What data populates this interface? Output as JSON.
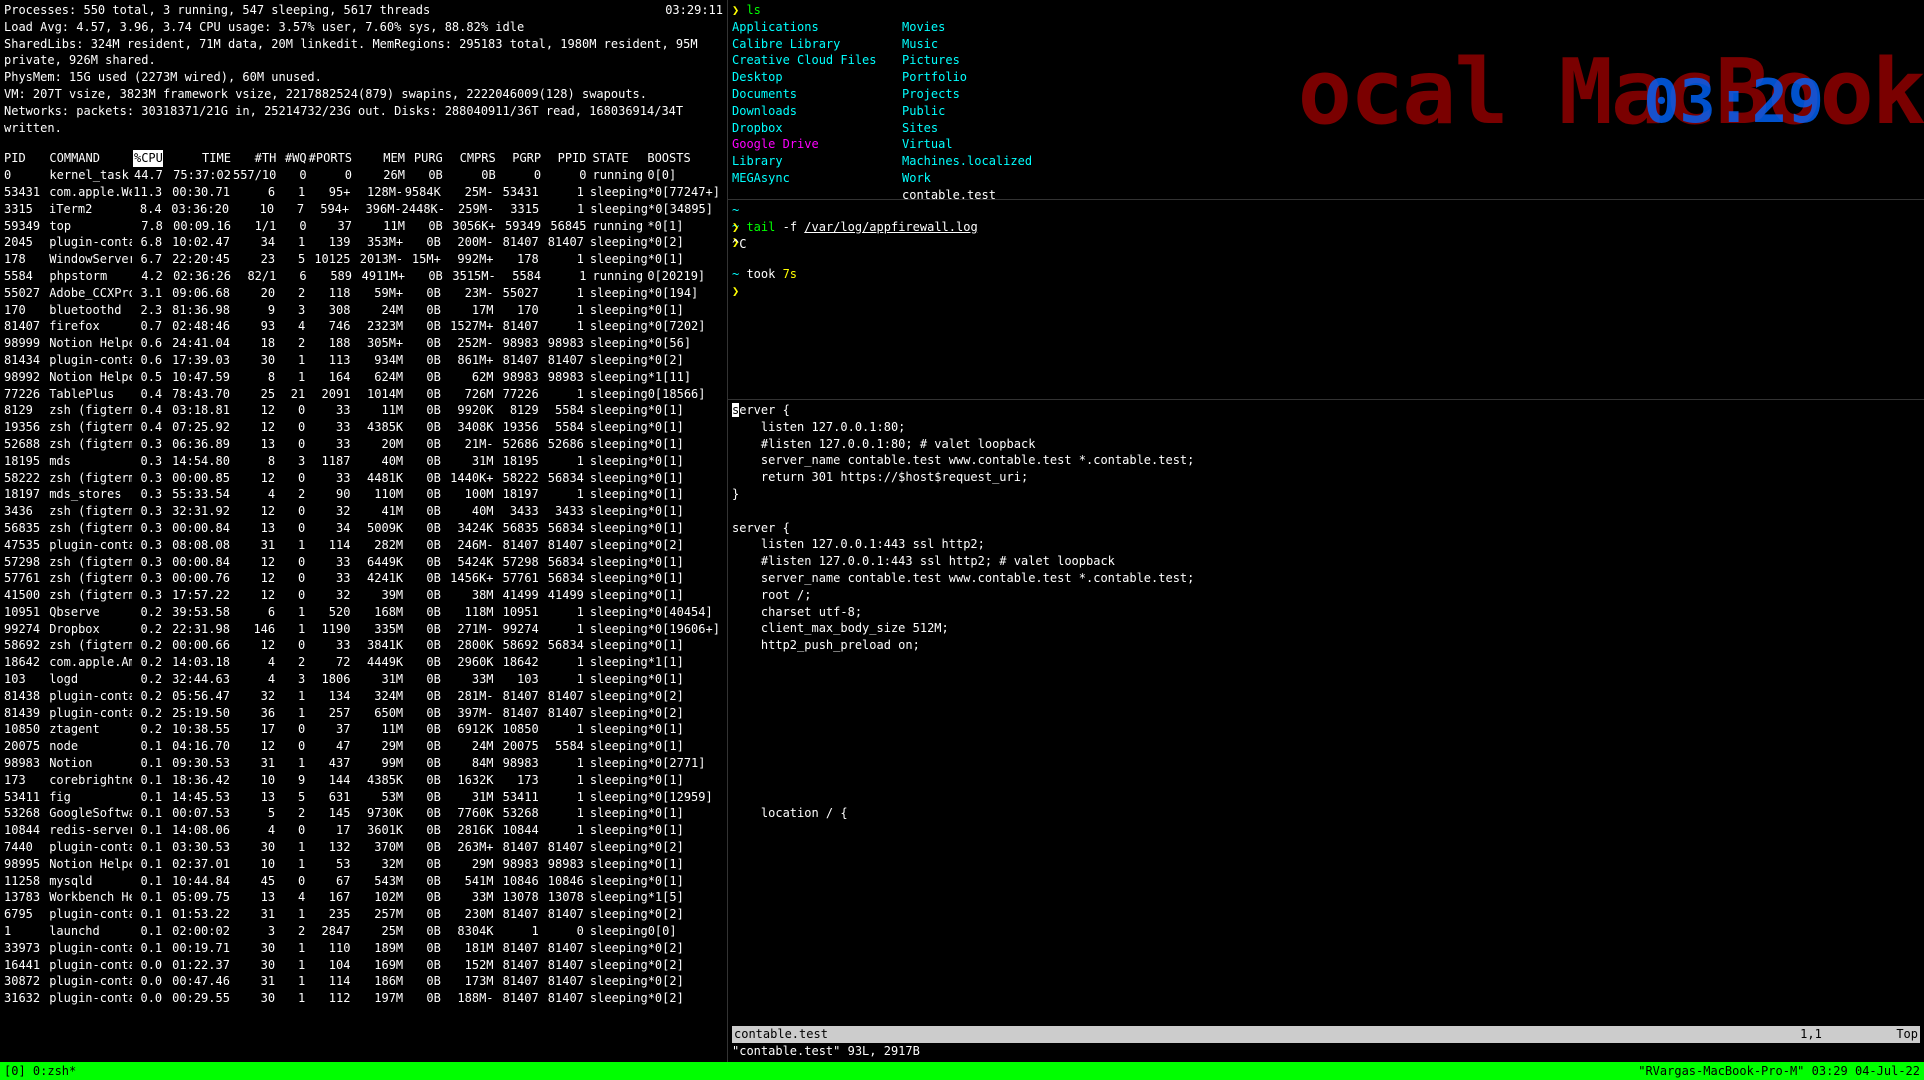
{
  "watermark": "ocal MacBook",
  "clock_time": "03:29",
  "top": {
    "summary": [
      "Processes: 550 total, 3 running, 547 sleeping, 5617 threads",
      "Load Avg: 4.57, 3.96, 3.74  CPU usage: 3.57% user, 7.60% sys, 88.82% idle",
      "SharedLibs: 324M resident, 71M data, 20M linkedit. MemRegions: 295183 total, 1980M resident, 95M private, 926M shared.",
      "PhysMem: 15G used (2273M wired), 60M unused.",
      "VM: 207T vsize, 3823M framework vsize, 2217882524(879) swapins, 2222046009(128) swapouts.",
      "Networks: packets: 30318371/21G in, 25214732/23G out. Disks: 288040911/36T read, 168036914/34T written."
    ],
    "timestamp": "03:29:11",
    "columns": [
      "PID",
      "COMMAND",
      "%CPU",
      "TIME",
      "#TH",
      "#WQ",
      "#PORTS",
      "MEM",
      "PURG",
      "CMPRS",
      "PGRP",
      "PPID",
      "STATE",
      "BOOSTS"
    ],
    "rows": [
      [
        "0",
        "kernel_task",
        "44.7",
        "75:37:02",
        "557/10",
        "0",
        "0",
        "26M",
        "0B",
        "0B",
        "0",
        "0",
        "running",
        "0[0]"
      ],
      [
        "53431",
        "com.apple.We",
        "11.3",
        "00:30.71",
        "6",
        "1",
        "95+",
        "128M-",
        "9584K",
        "25M-",
        "53431",
        "1",
        "sleeping",
        "*0[77247+]"
      ],
      [
        "3315",
        "iTerm2",
        "8.4",
        "03:36:20",
        "10",
        "7",
        "594+",
        "396M-",
        "2448K-",
        "259M-",
        "3315",
        "1",
        "sleeping",
        "*0[34895]"
      ],
      [
        "59349",
        "top",
        "7.8",
        "00:09.16",
        "1/1",
        "0",
        "37",
        "11M",
        "0B",
        "3056K+",
        "59349",
        "56845",
        "running",
        "*0[1]"
      ],
      [
        "2045",
        "plugin-conta",
        "6.8",
        "10:02.47",
        "34",
        "1",
        "139",
        "353M+",
        "0B",
        "200M-",
        "81407",
        "81407",
        "sleeping",
        "*0[2]"
      ],
      [
        "178",
        "WindowServer",
        "6.7",
        "22:20:45",
        "23",
        "5",
        "10125",
        "2013M-",
        "15M+",
        "992M+",
        "178",
        "1",
        "sleeping",
        "*0[1]"
      ],
      [
        "5584",
        "phpstorm",
        "4.2",
        "02:36:26",
        "82/1",
        "6",
        "589",
        "4911M+",
        "0B",
        "3515M-",
        "5584",
        "1",
        "running",
        "0[20219]"
      ],
      [
        "55027",
        "Adobe_CCXPro",
        "3.1",
        "09:06.68",
        "20",
        "2",
        "118",
        "59M+",
        "0B",
        "23M-",
        "55027",
        "1",
        "sleeping",
        "*0[194]"
      ],
      [
        "170",
        "bluetoothd",
        "2.3",
        "81:36.98",
        "9",
        "3",
        "308",
        "24M",
        "0B",
        "17M",
        "170",
        "1",
        "sleeping",
        "*0[1]"
      ],
      [
        "81407",
        "firefox",
        "0.7",
        "02:48:46",
        "93",
        "4",
        "746",
        "2323M",
        "0B",
        "1527M+",
        "81407",
        "1",
        "sleeping",
        "*0[7202]"
      ],
      [
        "98999",
        "Notion Helpe",
        "0.6",
        "24:41.04",
        "18",
        "2",
        "188",
        "305M+",
        "0B",
        "252M-",
        "98983",
        "98983",
        "sleeping",
        "*0[56]"
      ],
      [
        "81434",
        "plugin-conta",
        "0.6",
        "17:39.03",
        "30",
        "1",
        "113",
        "934M",
        "0B",
        "861M+",
        "81407",
        "81407",
        "sleeping",
        "*0[2]"
      ],
      [
        "98992",
        "Notion Helpe",
        "0.5",
        "10:47.59",
        "8",
        "1",
        "164",
        "624M",
        "0B",
        "62M",
        "98983",
        "98983",
        "sleeping",
        "*1[11]"
      ],
      [
        "77226",
        "TablePlus",
        "0.4",
        "78:43.70",
        "25",
        "21",
        "2091",
        "1014M",
        "0B",
        "726M",
        "77226",
        "1",
        "sleeping",
        "0[18566]"
      ],
      [
        "8129",
        "zsh (figterm",
        "0.4",
        "03:18.81",
        "12",
        "0",
        "33",
        "11M",
        "0B",
        "9920K",
        "8129",
        "5584",
        "sleeping",
        "*0[1]"
      ],
      [
        "19356",
        "zsh (figterm",
        "0.4",
        "07:25.92",
        "12",
        "0",
        "33",
        "4385K",
        "0B",
        "3408K",
        "19356",
        "5584",
        "sleeping",
        "*0[1]"
      ],
      [
        "52688",
        "zsh (figterm",
        "0.3",
        "06:36.89",
        "13",
        "0",
        "33",
        "20M",
        "0B",
        "21M-",
        "52686",
        "52686",
        "sleeping",
        "*0[1]"
      ],
      [
        "18195",
        "mds",
        "0.3",
        "14:54.80",
        "8",
        "3",
        "1187",
        "40M",
        "0B",
        "31M",
        "18195",
        "1",
        "sleeping",
        "*0[1]"
      ],
      [
        "58222",
        "zsh (figterm",
        "0.3",
        "00:00.85",
        "12",
        "0",
        "33",
        "4481K",
        "0B",
        "1440K+",
        "58222",
        "56834",
        "sleeping",
        "*0[1]"
      ],
      [
        "18197",
        "mds_stores",
        "0.3",
        "55:33.54",
        "4",
        "2",
        "90",
        "110M",
        "0B",
        "100M",
        "18197",
        "1",
        "sleeping",
        "*0[1]"
      ],
      [
        "3436",
        "zsh (figterm",
        "0.3",
        "32:31.92",
        "12",
        "0",
        "32",
        "41M",
        "0B",
        "40M",
        "3433",
        "3433",
        "sleeping",
        "*0[1]"
      ],
      [
        "56835",
        "zsh (figterm",
        "0.3",
        "00:00.84",
        "13",
        "0",
        "34",
        "5009K",
        "0B",
        "3424K",
        "56835",
        "56834",
        "sleeping",
        "*0[1]"
      ],
      [
        "47535",
        "plugin-conta",
        "0.3",
        "08:08.08",
        "31",
        "1",
        "114",
        "282M",
        "0B",
        "246M-",
        "81407",
        "81407",
        "sleeping",
        "*0[2]"
      ],
      [
        "57298",
        "zsh (figterm",
        "0.3",
        "00:00.84",
        "12",
        "0",
        "33",
        "6449K",
        "0B",
        "5424K",
        "57298",
        "56834",
        "sleeping",
        "*0[1]"
      ],
      [
        "57761",
        "zsh (figterm",
        "0.3",
        "00:00.76",
        "12",
        "0",
        "33",
        "4241K",
        "0B",
        "1456K+",
        "57761",
        "56834",
        "sleeping",
        "*0[1]"
      ],
      [
        "41500",
        "zsh (figterm",
        "0.3",
        "17:57.22",
        "12",
        "0",
        "32",
        "39M",
        "0B",
        "38M",
        "41499",
        "41499",
        "sleeping",
        "*0[1]"
      ],
      [
        "10951",
        "Qbserve",
        "0.2",
        "39:53.58",
        "6",
        "1",
        "520",
        "168M",
        "0B",
        "118M",
        "10951",
        "1",
        "sleeping",
        "*0[40454]"
      ],
      [
        "99274",
        "Dropbox",
        "0.2",
        "22:31.98",
        "146",
        "1",
        "1190",
        "335M",
        "0B",
        "271M-",
        "99274",
        "1",
        "sleeping",
        "*0[19606+]"
      ],
      [
        "58692",
        "zsh (figterm",
        "0.2",
        "00:00.66",
        "12",
        "0",
        "33",
        "3841K",
        "0B",
        "2800K",
        "58692",
        "56834",
        "sleeping",
        "*0[1]"
      ],
      [
        "18642",
        "com.apple.Am",
        "0.2",
        "14:03.18",
        "4",
        "2",
        "72",
        "4449K",
        "0B",
        "2960K",
        "18642",
        "1",
        "sleeping",
        "*1[1]"
      ],
      [
        "103",
        "logd",
        "0.2",
        "32:44.63",
        "4",
        "3",
        "1806",
        "31M",
        "0B",
        "33M",
        "103",
        "1",
        "sleeping",
        "*0[1]"
      ],
      [
        "81438",
        "plugin-conta",
        "0.2",
        "05:56.47",
        "32",
        "1",
        "134",
        "324M",
        "0B",
        "281M-",
        "81407",
        "81407",
        "sleeping",
        "*0[2]"
      ],
      [
        "81439",
        "plugin-conta",
        "0.2",
        "25:19.50",
        "36",
        "1",
        "257",
        "650M",
        "0B",
        "397M-",
        "81407",
        "81407",
        "sleeping",
        "*0[2]"
      ],
      [
        "10850",
        "ztagent",
        "0.2",
        "10:38.55",
        "17",
        "0",
        "37",
        "11M",
        "0B",
        "6912K",
        "10850",
        "1",
        "sleeping",
        "*0[1]"
      ],
      [
        "20075",
        "node",
        "0.1",
        "04:16.70",
        "12",
        "0",
        "47",
        "29M",
        "0B",
        "24M",
        "20075",
        "5584",
        "sleeping",
        "*0[1]"
      ],
      [
        "98983",
        "Notion",
        "0.1",
        "09:30.53",
        "31",
        "1",
        "437",
        "99M",
        "0B",
        "84M",
        "98983",
        "1",
        "sleeping",
        "*0[2771]"
      ],
      [
        "173",
        "corebrightne",
        "0.1",
        "18:36.42",
        "10",
        "9",
        "144",
        "4385K",
        "0B",
        "1632K",
        "173",
        "1",
        "sleeping",
        "*0[1]"
      ],
      [
        "53411",
        "fig",
        "0.1",
        "14:45.53",
        "13",
        "5",
        "631",
        "53M",
        "0B",
        "31M",
        "53411",
        "1",
        "sleeping",
        "*0[12959]"
      ],
      [
        "53268",
        "GoogleSoftwa",
        "0.1",
        "00:07.53",
        "5",
        "2",
        "145",
        "9730K",
        "0B",
        "7760K",
        "53268",
        "1",
        "sleeping",
        "*0[1]"
      ],
      [
        "10844",
        "redis-server",
        "0.1",
        "14:08.06",
        "4",
        "0",
        "17",
        "3601K",
        "0B",
        "2816K",
        "10844",
        "1",
        "sleeping",
        "*0[1]"
      ],
      [
        "7440",
        "plugin-conta",
        "0.1",
        "03:30.53",
        "30",
        "1",
        "132",
        "370M",
        "0B",
        "263M+",
        "81407",
        "81407",
        "sleeping",
        "*0[2]"
      ],
      [
        "98995",
        "Notion Helpe",
        "0.1",
        "02:37.01",
        "10",
        "1",
        "53",
        "32M",
        "0B",
        "29M",
        "98983",
        "98983",
        "sleeping",
        "*0[1]"
      ],
      [
        "11258",
        "mysqld",
        "0.1",
        "10:44.84",
        "45",
        "0",
        "67",
        "543M",
        "0B",
        "541M",
        "10846",
        "10846",
        "sleeping",
        "*0[1]"
      ],
      [
        "13783",
        "Workbench He",
        "0.1",
        "05:09.75",
        "13",
        "4",
        "167",
        "102M",
        "0B",
        "33M",
        "13078",
        "13078",
        "sleeping",
        "*1[5]"
      ],
      [
        "6795",
        "plugin-conta",
        "0.1",
        "01:53.22",
        "31",
        "1",
        "235",
        "257M",
        "0B",
        "230M",
        "81407",
        "81407",
        "sleeping",
        "*0[2]"
      ],
      [
        "1",
        "launchd",
        "0.1",
        "02:00:02",
        "3",
        "2",
        "2847",
        "25M",
        "0B",
        "8304K",
        "1",
        "0",
        "sleeping",
        "0[0]"
      ],
      [
        "33973",
        "plugin-conta",
        "0.1",
        "00:19.71",
        "30",
        "1",
        "110",
        "189M",
        "0B",
        "181M",
        "81407",
        "81407",
        "sleeping",
        "*0[2]"
      ],
      [
        "16441",
        "plugin-conta",
        "0.0",
        "01:22.37",
        "30",
        "1",
        "104",
        "169M",
        "0B",
        "152M",
        "81407",
        "81407",
        "sleeping",
        "*0[2]"
      ],
      [
        "30872",
        "plugin-conta",
        "0.0",
        "00:47.46",
        "31",
        "1",
        "114",
        "186M",
        "0B",
        "173M",
        "81407",
        "81407",
        "sleeping",
        "*0[2]"
      ],
      [
        "31632",
        "plugin-conta",
        "0.0",
        "00:29.55",
        "30",
        "1",
        "112",
        "197M",
        "0B",
        "188M-",
        "81407",
        "81407",
        "sleeping",
        "*0[2]"
      ]
    ]
  },
  "ls": {
    "command": "ls",
    "col1": [
      "Applications",
      "Calibre Library",
      "Creative Cloud Files",
      "Desktop",
      "Documents",
      "Downloads",
      "Dropbox",
      "Google Drive",
      "Library",
      "MEGAsync"
    ],
    "col2": [
      "Movies",
      "Music",
      "Pictures",
      "Portfolio",
      "Projects",
      "Public",
      "Sites",
      "Virtual Machines.localized",
      "Work",
      "contable.test"
    ],
    "col1_colors": [
      "cyan",
      "cyan",
      "cyan",
      "cyan",
      "cyan",
      "cyan",
      "cyan",
      "magenta",
      "cyan",
      "cyan"
    ],
    "col2_colors": [
      "cyan",
      "cyan",
      "cyan",
      "cyan",
      "cyan",
      "cyan",
      "cyan",
      "cyan",
      "cyan",
      "white"
    ]
  },
  "middle_pane": {
    "prompt_cmd": "tail",
    "prompt_args": " -f ",
    "prompt_path": "/var/log/appfirewall.log",
    "ctrl_c": "^C",
    "took_label": "took ",
    "took_time": "7s"
  },
  "vim": {
    "lines": [
      "server {",
      "    listen 127.0.0.1:80;",
      "    #listen 127.0.0.1:80; # valet loopback",
      "    server_name contable.test www.contable.test *.contable.test;",
      "    return 301 https://$host$request_uri;",
      "}",
      "",
      "server {",
      "    listen 127.0.0.1:443 ssl http2;",
      "    #listen 127.0.0.1:443 ssl http2; # valet loopback",
      "    server_name contable.test www.contable.test *.contable.test;",
      "    root /;",
      "    charset utf-8;",
      "    client_max_body_size 512M;",
      "    http2_push_preload on;",
      "",
      "",
      "",
      "",
      "",
      "",
      "",
      "",
      "",
      "    location / {"
    ],
    "status_file": "contable.test",
    "status_pos": "1,1",
    "status_scroll": "Top",
    "status_cmd": "\"contable.test\" 93L, 2917B"
  },
  "tmux": {
    "left": "[0] 0:zsh*",
    "right": "\"RVargas-MacBook-Pro-M\" 03:29 04-Jul-22"
  },
  "tilde": "~"
}
